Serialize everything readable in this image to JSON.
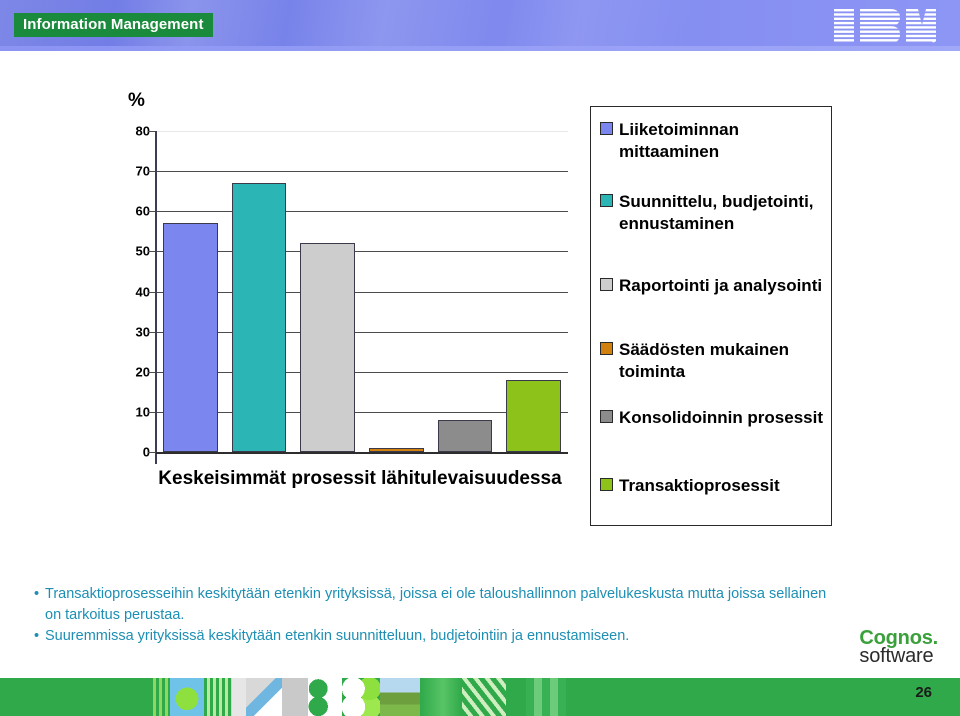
{
  "header": {
    "brand_tag": "Information Management",
    "logo_text": "IBM",
    "banner_color": "#7883ea",
    "tag_color": "#1a8a3c"
  },
  "chart_data": {
    "type": "bar",
    "title": "",
    "xlabel": "Keskeisimmät prosessit lähitulevaisuudessa",
    "ylabel": "%",
    "ylim": [
      0,
      80
    ],
    "yticks": [
      "80",
      "70",
      "60",
      "50",
      "40",
      "30",
      "20",
      "10",
      "0"
    ],
    "ytick_values": [
      80,
      70,
      60,
      50,
      40,
      30,
      20,
      10,
      0
    ],
    "grid": true,
    "legend_position": "right",
    "categories": [
      "Liiketoiminnan mittaaminen",
      "Suunnittelu, budjetointi, ennustaminen",
      "Raportointi ja analysointi",
      "Säädösten mukainen toiminta",
      "Konsolidoinnin prosessit",
      "Transaktioprosessit"
    ],
    "values": [
      57,
      67,
      52,
      1,
      8,
      18
    ],
    "colors": [
      "#7b86ee",
      "#2bb5b5",
      "#cdcdcd",
      "#d2810e",
      "#8c8c8c",
      "#8dc21a"
    ]
  },
  "legend": {
    "items": [
      {
        "label": "Liiketoiminnan mittaaminen",
        "color": "#7b86ee"
      },
      {
        "label": "Suunnittelu, budjetointi, ennustaminen",
        "color": "#2bb5b5"
      },
      {
        "label": "Raportointi ja analysointi",
        "color": "#cdcdcd"
      },
      {
        "label": "Säädösten mukainen toiminta",
        "color": "#d2810e"
      },
      {
        "label": "Konsolidoinnin prosessit",
        "color": "#8c8c8c"
      },
      {
        "label": "Transaktioprosessit",
        "color": "#8dc21a"
      }
    ]
  },
  "bullets": {
    "marker": "•",
    "items": [
      "Transaktioprosesseihin keskitytään etenkin yrityksissä, joissa ei ole taloushallinnon palvelukeskusta mutta joissa sellainen on tarkoitus perustaa.",
      "Suuremmissa yrityksissä keskitytään etenkin suunnitteluun, budjetointiin ja ennustamiseen."
    ],
    "color": "#1d8fb4"
  },
  "footer": {
    "cognos_name": "Cognos.",
    "cognos_sub": "software",
    "page_number": "26"
  }
}
